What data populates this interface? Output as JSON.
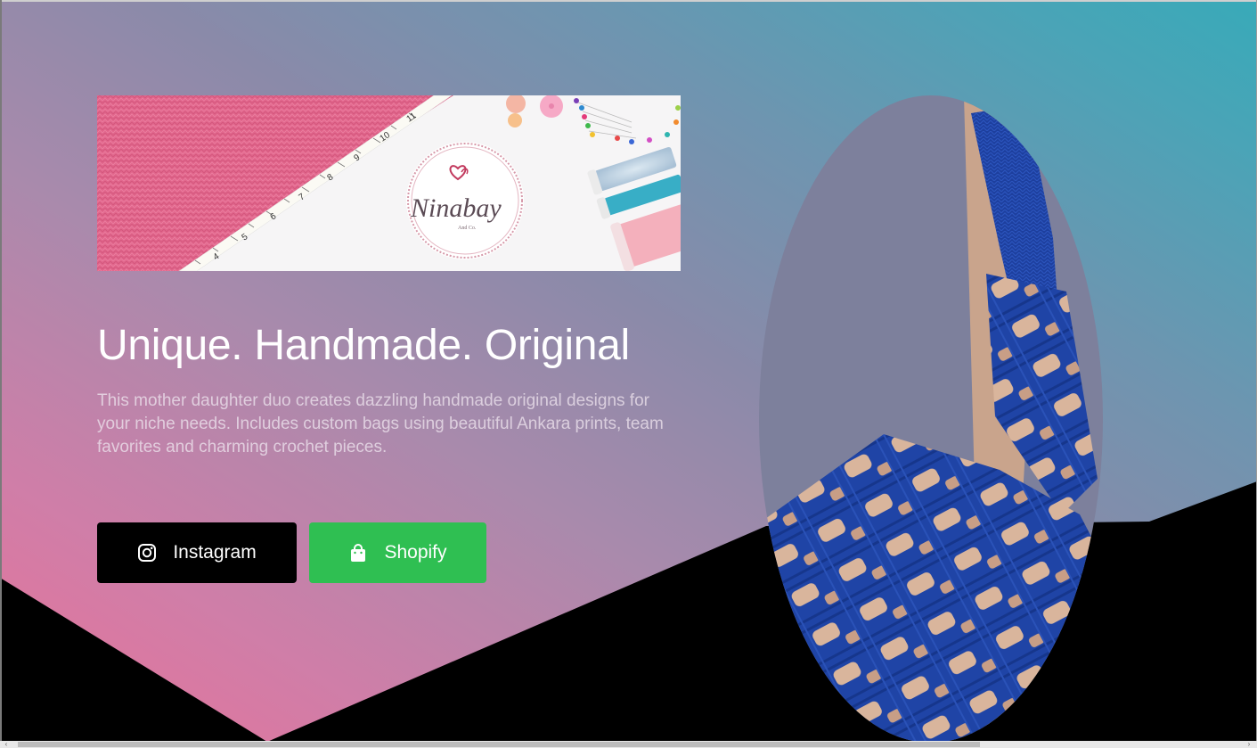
{
  "hero": {
    "title": "Unique. Handmade. Original",
    "description": "This mother daughter duo creates dazzling handmade original designs for your niche needs. Includes custom bags using beautiful Ankara prints, team favorites and charming crochet pieces."
  },
  "banner": {
    "logo_text": "Ninabay",
    "logo_subtext": "And Co.",
    "tape_numbers": [
      "4",
      "5",
      "6",
      "7",
      "8",
      "9",
      "10",
      "11"
    ]
  },
  "buttons": {
    "instagram": {
      "label": "Instagram",
      "icon": "instagram-icon"
    },
    "shopify": {
      "label": "Shopify",
      "icon": "shopping-bag-icon"
    }
  },
  "colors": {
    "gradient_pink": "#e97299",
    "gradient_teal": "#38aab8",
    "shopify_green": "#2fbf52",
    "instagram_black": "#000000",
    "crochet_blue": "#1e40a0"
  },
  "scrollbar": {
    "left_arrow": "‹",
    "right_arrow": "›"
  }
}
